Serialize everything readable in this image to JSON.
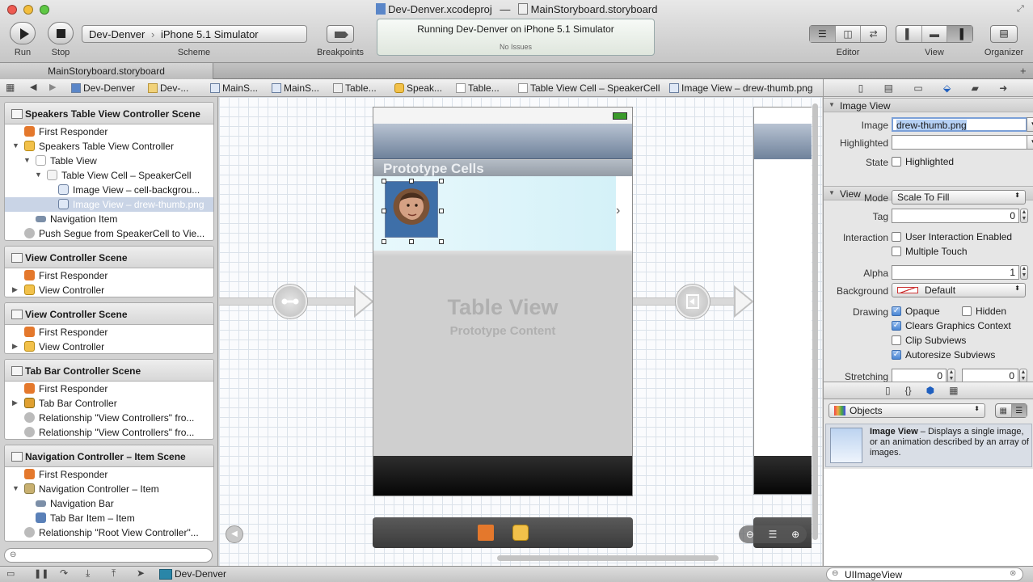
{
  "window": {
    "title_project": "Dev-Denver.xcodeproj",
    "title_separator": "—",
    "title_file": "MainStoryboard.storyboard"
  },
  "toolbar": {
    "run_label": "Run",
    "stop_label": "Stop",
    "scheme_target": "Dev-Denver",
    "scheme_device": "iPhone 5.1 Simulator",
    "scheme_label": "Scheme",
    "breakpoints_label": "Breakpoints",
    "status_text": "Running Dev-Denver on iPhone 5.1 Simulator",
    "status_issues": "No Issues",
    "editor_label": "Editor",
    "view_label": "View",
    "organizer_label": "Organizer"
  },
  "tabbar": {
    "tab_label": "MainStoryboard.storyboard",
    "add_tab": "+"
  },
  "jumpbar": {
    "crumbs": [
      "Dev-Denver",
      "Dev-...",
      "MainS...",
      "MainS...",
      "Table...",
      "Speak...",
      "Table...",
      "Table View Cell – SpeakerCell",
      "Image View – drew-thumb.png"
    ]
  },
  "outline": {
    "scenes": [
      {
        "title": "Speakers Table View Controller Scene",
        "rows": [
          {
            "label": "First Responder"
          },
          {
            "label": "Speakers Table View Controller"
          },
          {
            "label": "Table View"
          },
          {
            "label": "Table View Cell – SpeakerCell"
          },
          {
            "label": "Image View – cell-backgrou..."
          },
          {
            "label": "Image View – drew-thumb.png"
          },
          {
            "label": "Navigation Item"
          },
          {
            "label": "Push Segue from SpeakerCell to Vie..."
          }
        ]
      },
      {
        "title": "View Controller Scene",
        "rows": [
          {
            "label": "First Responder"
          },
          {
            "label": "View Controller"
          }
        ]
      },
      {
        "title": "View Controller Scene",
        "rows": [
          {
            "label": "First Responder"
          },
          {
            "label": "View Controller"
          }
        ]
      },
      {
        "title": "Tab Bar Controller Scene",
        "rows": [
          {
            "label": "First Responder"
          },
          {
            "label": "Tab Bar Controller"
          },
          {
            "label": "Relationship \"View Controllers\" fro..."
          },
          {
            "label": "Relationship \"View Controllers\" fro..."
          }
        ]
      },
      {
        "title": "Navigation Controller – Item Scene",
        "rows": [
          {
            "label": "First Responder"
          },
          {
            "label": "Navigation Controller – Item"
          },
          {
            "label": "Navigation Bar"
          },
          {
            "label": "Tab Bar Item – Item"
          },
          {
            "label": "Relationship \"Root View Controller\"..."
          }
        ]
      }
    ]
  },
  "canvas": {
    "prototype_cells": "Prototype Cells",
    "table_view": "Table View",
    "prototype_content": "Prototype Content"
  },
  "inspector": {
    "image_view_section": "Image View",
    "image_label": "Image",
    "image_value": "drew-thumb.png",
    "highlighted_label": "Highlighted",
    "highlighted_value": "",
    "state_label": "State",
    "state_checkbox": "Highlighted",
    "view_section": "View",
    "mode_label": "Mode",
    "mode_value": "Scale To Fill",
    "tag_label": "Tag",
    "tag_value": "0",
    "interaction_label": "Interaction",
    "user_interaction": "User Interaction Enabled",
    "multiple_touch": "Multiple Touch",
    "alpha_label": "Alpha",
    "alpha_value": "1",
    "background_label": "Background",
    "background_value": "Default",
    "drawing_label": "Drawing",
    "opaque": "Opaque",
    "hidden": "Hidden",
    "clears_graphics": "Clears Graphics Context",
    "clip_subviews": "Clip Subviews",
    "autoresize": "Autoresize Subviews",
    "stretching_label": "Stretching",
    "stretch_x": "0",
    "stretch_y": "0"
  },
  "library": {
    "objects_label": "Objects",
    "item_title": "Image View",
    "item_desc": "– Displays a single image, or an animation described by an array of images.",
    "filter_value": "UIImageView"
  },
  "bottombar": {
    "target_label": "Dev-Denver"
  }
}
